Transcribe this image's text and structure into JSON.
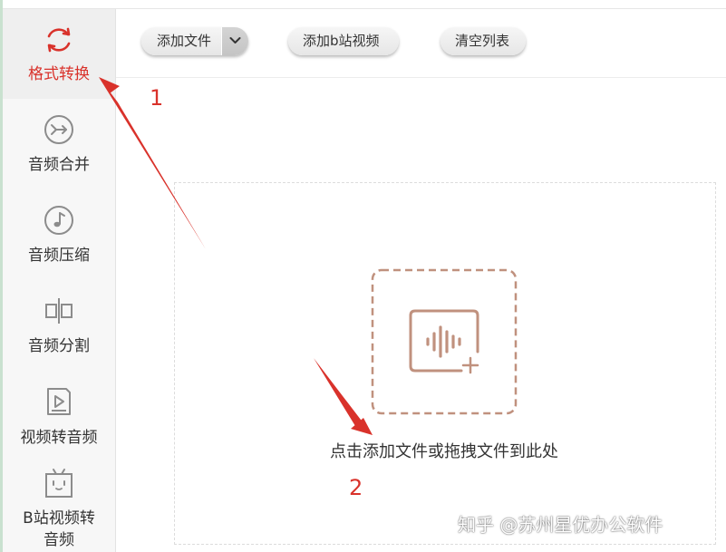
{
  "sidebar": {
    "items": [
      {
        "label": "格式转换",
        "icon": "refresh-icon",
        "active": true
      },
      {
        "label": "音频合并",
        "icon": "merge-icon"
      },
      {
        "label": "音频压缩",
        "icon": "music-note-icon"
      },
      {
        "label": "音频分割",
        "icon": "split-icon"
      },
      {
        "label": "视频转音频",
        "icon": "video-play-icon"
      },
      {
        "label_line1": "B站视频转",
        "label_line2": "音频",
        "icon": "bilibili-tv-icon"
      }
    ]
  },
  "toolbar": {
    "add_file_label": "添加文件",
    "add_bili_label": "添加b站视频",
    "clear_label": "清空列表"
  },
  "drop_zone": {
    "hint": "点击添加文件或拖拽文件到此处",
    "icon": "audio-add-icon"
  },
  "annotations": {
    "step1": "1",
    "step2": "2"
  },
  "watermark": "知乎 @苏州星优办公软件",
  "colors": {
    "accent": "#d9322b",
    "icon_tint": "#c0917e",
    "sidebar_bg": "#f7f7f7"
  }
}
